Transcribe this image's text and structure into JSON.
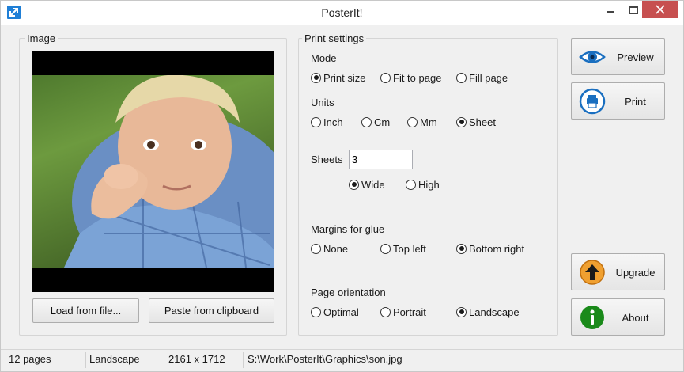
{
  "window": {
    "title": "PosterIt!"
  },
  "image_group": {
    "label": "Image",
    "load_button": "Load from file...",
    "paste_button": "Paste from clipboard"
  },
  "settings": {
    "label": "Print settings",
    "mode": {
      "label": "Mode",
      "options": [
        "Print size",
        "Fit to page",
        "Fill page"
      ],
      "selected": "Print size"
    },
    "units": {
      "label": "Units",
      "options": [
        "Inch",
        "Cm",
        "Mm",
        "Sheet"
      ],
      "selected": "Sheet"
    },
    "sheets": {
      "label": "Sheets",
      "value": "3",
      "options": [
        "Wide",
        "High"
      ],
      "selected": "Wide"
    },
    "margins": {
      "label": "Margins for glue",
      "options": [
        "None",
        "Top left",
        "Bottom right"
      ],
      "selected": "Bottom right"
    },
    "orientation": {
      "label": "Page orientation",
      "options": [
        "Optimal",
        "Portrait",
        "Landscape"
      ],
      "selected": "Landscape"
    }
  },
  "actions": {
    "preview": "Preview",
    "print": "Print",
    "upgrade": "Upgrade",
    "about": "About"
  },
  "icons": {
    "preview": "eye-icon",
    "print": "printer-icon",
    "upgrade": "arrow-up-icon",
    "about": "info-icon"
  },
  "status": {
    "pages": "12 pages",
    "orientation": "Landscape",
    "dimensions": "2161 x 1712",
    "path": "S:\\Work\\PosterIt\\Graphics\\son.jpg"
  },
  "colors": {
    "accent": "#1f7fd6",
    "upgrade": "#f0a030",
    "about": "#1a8a1a",
    "close": "#c75050"
  }
}
